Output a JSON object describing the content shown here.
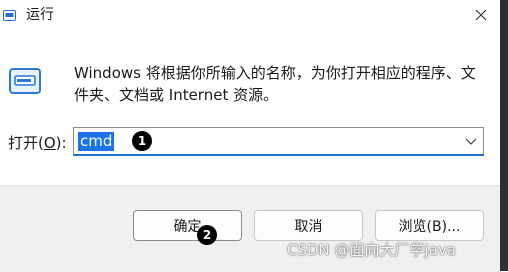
{
  "window": {
    "title": "运行",
    "close_icon": "close-icon"
  },
  "description": "Windows 将根据你所输入的名称，为你打开相应的程序、文件夹、文档或 Internet 资源。",
  "open": {
    "label_prefix": "打开(",
    "label_accel": "O",
    "label_suffix": "):",
    "value": "cmd",
    "badge": "1"
  },
  "buttons": {
    "ok": "确定",
    "ok_badge": "2",
    "cancel": "取消",
    "browse": "浏览(B)..."
  },
  "watermark": "CSDN @面向大厂学java",
  "colors": {
    "accent": "#1a73e8",
    "footer_bg": "#f0f0f0"
  }
}
